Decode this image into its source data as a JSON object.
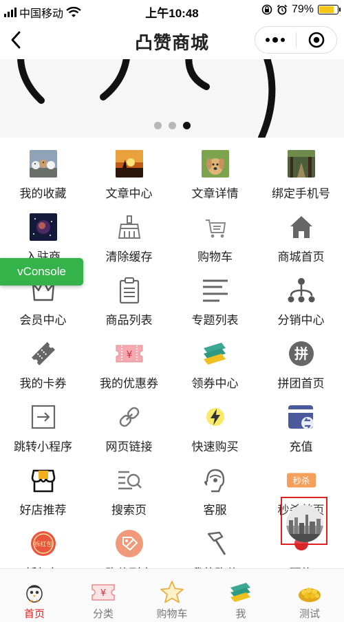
{
  "status_bar": {
    "carrier": "中国移动",
    "time": "上午10:48",
    "battery": "79%",
    "battery_level": 0.79
  },
  "nav": {
    "title": "凸赞商城"
  },
  "banner": {
    "slide_count": 3,
    "active_index": 2
  },
  "grid": [
    {
      "label": "我的收藏",
      "icon": "dogs-photo-icon"
    },
    {
      "label": "文章中心",
      "icon": "sunset-photo-icon"
    },
    {
      "label": "文章详情",
      "icon": "puppy-photo-icon"
    },
    {
      "label": "绑定手机号",
      "icon": "forest-photo-icon"
    },
    {
      "label": "入驻商",
      "icon": "galaxy-photo-icon"
    },
    {
      "label": "清除缓存",
      "icon": "broom-icon"
    },
    {
      "label": "购物车",
      "icon": "cart-icon"
    },
    {
      "label": "商城首页",
      "icon": "home-icon"
    },
    {
      "label": "会员中心",
      "icon": "crown-icon"
    },
    {
      "label": "商品列表",
      "icon": "clipboard-icon"
    },
    {
      "label": "专题列表",
      "icon": "lines-icon"
    },
    {
      "label": "分销中心",
      "icon": "network-icon"
    },
    {
      "label": "我的卡券",
      "icon": "ticket-icon"
    },
    {
      "label": "我的优惠券",
      "icon": "coupon-yen-icon"
    },
    {
      "label": "领券中心",
      "icon": "coupons-stack-icon"
    },
    {
      "label": "拼团首页",
      "icon": "group-buy-icon"
    },
    {
      "label": "跳转小程序",
      "icon": "arrow-box-icon"
    },
    {
      "label": "网页链接",
      "icon": "link-icon"
    },
    {
      "label": "快速购买",
      "icon": "lightning-icon"
    },
    {
      "label": "充值",
      "icon": "recharge-icon"
    },
    {
      "label": "好店推荐",
      "icon": "shop-icon"
    },
    {
      "label": "搜索页",
      "icon": "search-list-icon"
    },
    {
      "label": "客服",
      "icon": "headset-icon"
    },
    {
      "label": "秒杀首页",
      "icon": "flash-sale-icon"
    },
    {
      "label": "拆红包",
      "icon": "red-packet-icon"
    },
    {
      "label": "砍价列表",
      "icon": "bargain-tag-icon"
    },
    {
      "label": "我的砍价",
      "icon": "axe-icon"
    },
    {
      "label": "预约",
      "icon": "appointment-icon"
    }
  ],
  "grid_badges": {
    "group_buy": "拼",
    "flash_sale": "秒杀",
    "red_packet": "拆红包",
    "coupon": "¥"
  },
  "vconsole": {
    "label": "vConsole"
  },
  "tabs": [
    {
      "label": "首页",
      "icon": "bird-icon",
      "active": true
    },
    {
      "label": "分类",
      "icon": "category-ticket-icon",
      "active": false
    },
    {
      "label": "购物车",
      "icon": "star-icon",
      "active": false
    },
    {
      "label": "我",
      "icon": "coupons-icon",
      "active": false
    },
    {
      "label": "测试",
      "icon": "corn-icon",
      "active": false
    }
  ],
  "tab_badge": {
    "category": "¥"
  },
  "colors": {
    "accent_red": "#e02020",
    "vconsole_green": "#34b34a",
    "teal": "#3aa893"
  }
}
